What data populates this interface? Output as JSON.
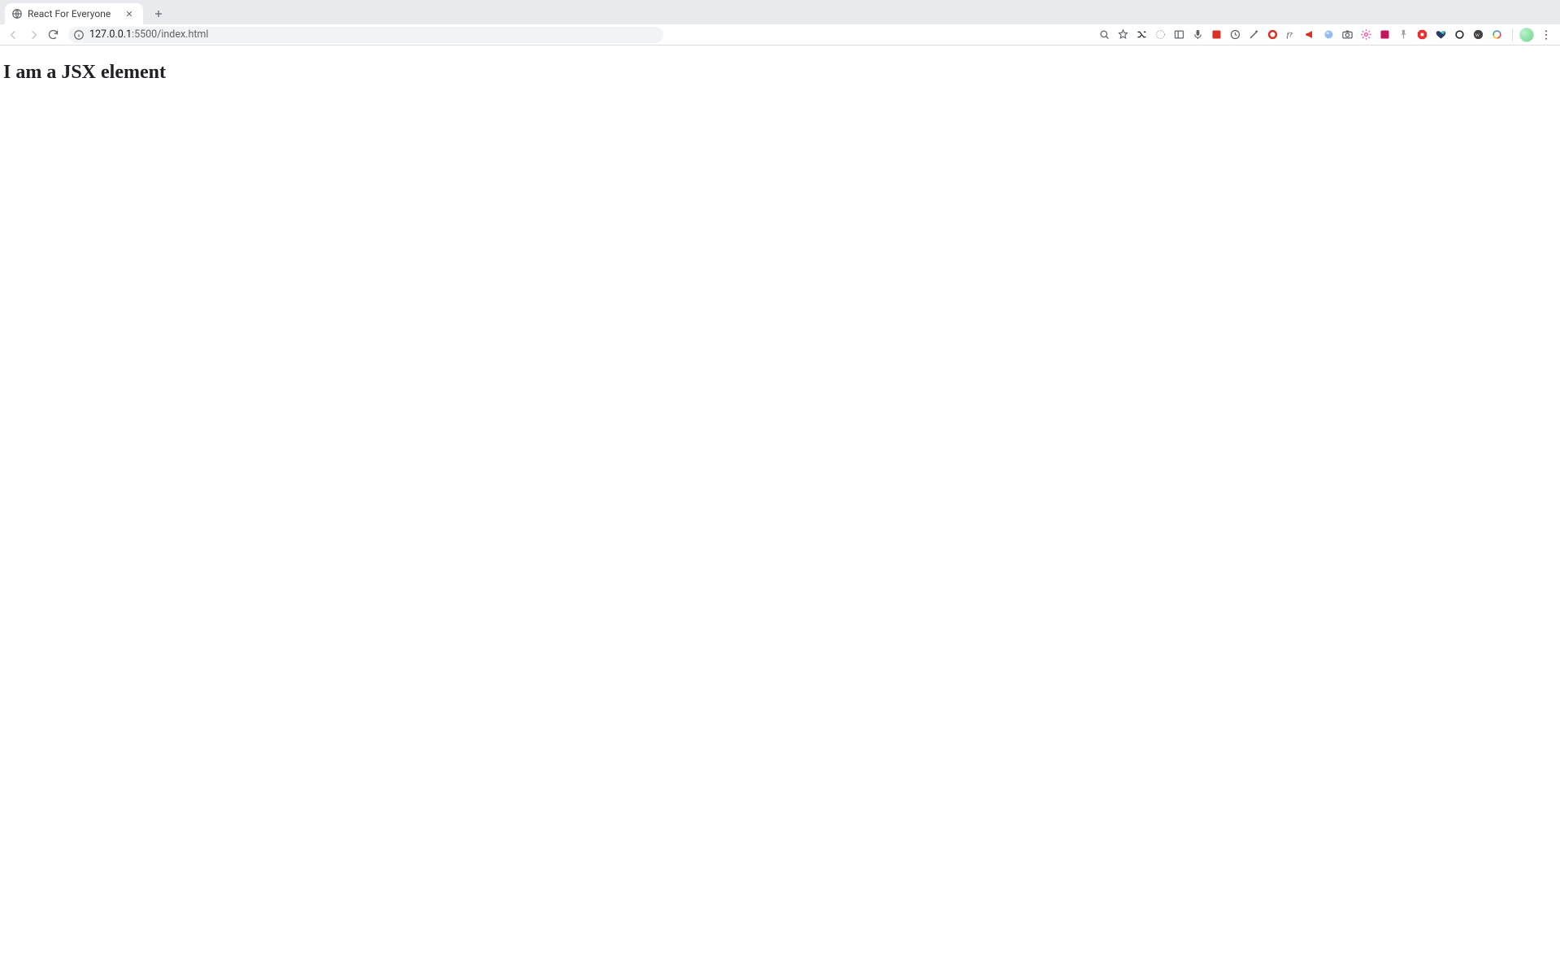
{
  "tab": {
    "title": "React For Everyone"
  },
  "url": {
    "host": "127.0.0.1",
    "path": ":5500/index.html"
  },
  "page": {
    "heading": "I am a JSX element"
  },
  "extensions": [
    {
      "name": "search-icon",
      "color": "#5f6368",
      "shape": "search"
    },
    {
      "name": "star-icon",
      "color": "#5f6368",
      "shape": "star"
    },
    {
      "name": "shuffle-icon",
      "color": "#202124",
      "shape": "shuffle"
    },
    {
      "name": "globe-dashed-icon",
      "color": "#9aa0a6",
      "shape": "globe"
    },
    {
      "name": "panel-icon",
      "color": "#5f6368",
      "shape": "panel"
    },
    {
      "name": "mic-icon",
      "color": "#5f6368",
      "shape": "mic"
    },
    {
      "name": "red-box-icon",
      "color": "#d93025",
      "shape": "box"
    },
    {
      "name": "clock-icon",
      "color": "#5f6368",
      "shape": "clock"
    },
    {
      "name": "wand-icon",
      "color": "#5f6368",
      "shape": "wand"
    },
    {
      "name": "red-o-icon",
      "color": "#d93025",
      "shape": "o"
    },
    {
      "name": "f-question-icon",
      "color": "#202124",
      "shape": "fq"
    },
    {
      "name": "megaphone-icon",
      "color": "#d93025",
      "shape": "megaphone"
    },
    {
      "name": "blue-sphere-icon",
      "color": "#4f8ff7",
      "shape": "sphere"
    },
    {
      "name": "camera-icon",
      "color": "#5f6368",
      "shape": "camera"
    },
    {
      "name": "pink-gear-icon",
      "color": "#ff3ea5",
      "shape": "gear"
    },
    {
      "name": "magenta-box-icon",
      "color": "#c2185b",
      "shape": "box"
    },
    {
      "name": "gray-pin-icon",
      "color": "#9aa0a6",
      "shape": "pin"
    },
    {
      "name": "red-stop-icon",
      "color": "#ea2e2e",
      "shape": "stop"
    },
    {
      "name": "heart-icon",
      "color": "#2b3a67",
      "shape": "heart"
    },
    {
      "name": "dark-ring-icon",
      "color": "#202124",
      "shape": "ring"
    },
    {
      "name": "wp-icon",
      "color": "#464342",
      "shape": "wp"
    },
    {
      "name": "rainbow-ring-icon",
      "color": "#34a853",
      "shape": "rainbowring"
    }
  ]
}
